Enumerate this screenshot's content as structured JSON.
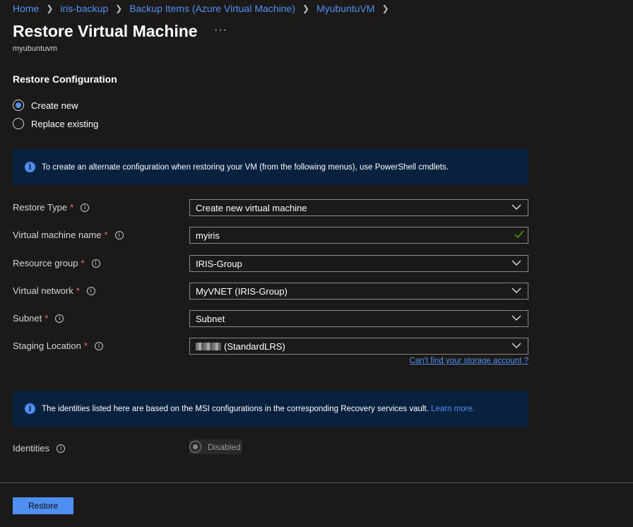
{
  "breadcrumb": [
    "Home",
    "iris-backup",
    "Backup Items (Azure Virtual Machine)",
    "MyubuntuVM"
  ],
  "page": {
    "title": "Restore Virtual Machine",
    "ellipsis": "···",
    "subtitle": "myubuntuvm"
  },
  "restore_config": {
    "heading": "Restore Configuration",
    "options": [
      {
        "label": "Create new",
        "selected": true
      },
      {
        "label": "Replace existing",
        "selected": false
      }
    ]
  },
  "info1": {
    "icon": "i",
    "text": "To create an alternate configuration when restoring your VM (from the following menus), use PowerShell cmdlets."
  },
  "form": {
    "fields": [
      {
        "label": "Restore Type",
        "value": "Create new virtual machine",
        "type": "dropdown"
      },
      {
        "label": "Virtual machine name",
        "value": "myiris",
        "type": "text-valid"
      },
      {
        "label": "Resource group",
        "value": "IRIS-Group",
        "type": "dropdown"
      },
      {
        "label": "Virtual network",
        "value": "MyVNET (IRIS-Group)",
        "type": "dropdown"
      },
      {
        "label": "Subnet",
        "value": "Subnet",
        "type": "dropdown"
      },
      {
        "label": "Staging Location",
        "value": "(StandardLRS)",
        "type": "dropdown"
      }
    ],
    "required_mark": "*",
    "help_icon": "i",
    "storage_link": "Can't find your storage account ?"
  },
  "info2": {
    "icon": "i",
    "text": "The identities listed here are based on the MSI configurations in the corresponding Recovery services vault.",
    "link": "Learn more."
  },
  "identities": {
    "label": "Identities",
    "value": "Disabled"
  },
  "footer": {
    "restore_button": "Restore"
  },
  "colors": {
    "background": "#1b1a19",
    "accent": "#4f8ff2",
    "info_bg": "#07213f",
    "required": "#f1707b",
    "valid": "#57a300"
  }
}
